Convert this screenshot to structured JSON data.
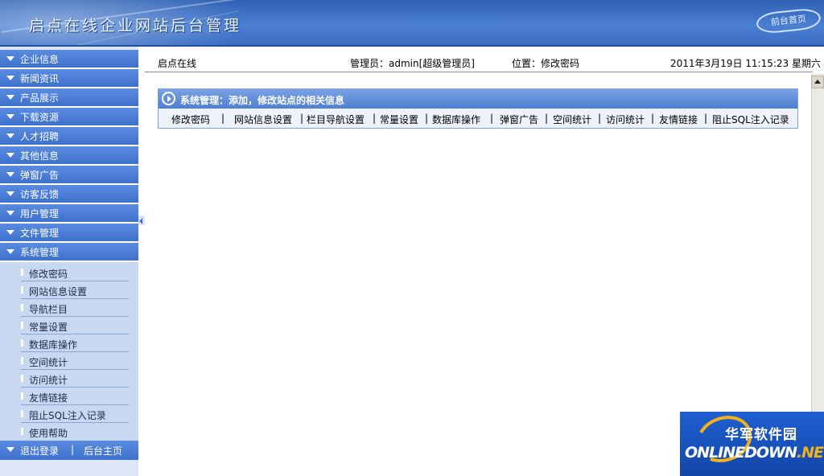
{
  "header": {
    "title": "启点在线企业网站后台管理",
    "front_link": "前台首页"
  },
  "sidebar": {
    "menu": [
      {
        "label": "企业信息"
      },
      {
        "label": "新闻资讯"
      },
      {
        "label": "产品展示"
      },
      {
        "label": "下载资源"
      },
      {
        "label": "人才招聘"
      },
      {
        "label": "其他信息"
      },
      {
        "label": "弹窗广告"
      },
      {
        "label": "访客反馈"
      },
      {
        "label": "用户管理"
      },
      {
        "label": "文件管理"
      },
      {
        "label": "系统管理"
      }
    ],
    "submenu": [
      {
        "label": "修改密码"
      },
      {
        "label": "网站信息设置"
      },
      {
        "label": "导航栏目"
      },
      {
        "label": "常量设置"
      },
      {
        "label": "数据库操作"
      },
      {
        "label": "空间统计"
      },
      {
        "label": "访问统计"
      },
      {
        "label": "友情链接"
      },
      {
        "label": "阻止SQL注入记录"
      },
      {
        "label": "使用帮助"
      }
    ],
    "logout": "退出登录",
    "separator": "|",
    "backend_home": "后台主页"
  },
  "infobar": {
    "site": "启点在线",
    "admin": "管理员：admin[超级管理员]",
    "location": "位置：修改密码",
    "datetime": "2011年3月19日 11:15:23 星期六"
  },
  "panel": {
    "title": "系统管理：添加，修改站点的相关信息",
    "links": [
      "修改密码",
      "网站信息设置",
      "栏目导航设置",
      "常量设置",
      "数据库操作",
      "弹窗广告",
      "空间统计",
      "访问统计",
      "友情链接",
      "阻止SQL注入记录"
    ],
    "separator": "|"
  },
  "watermark": {
    "cn": "华军软件园",
    "en_prefix": "ONLINEDOWN",
    "en_suffix": ".NET"
  },
  "colors": {
    "header_blue": "#3a6cc3",
    "menu_blue": "#3e71cc",
    "sidebar_bg": "#dde6f6",
    "submenu_bg": "#c9d8f1"
  }
}
